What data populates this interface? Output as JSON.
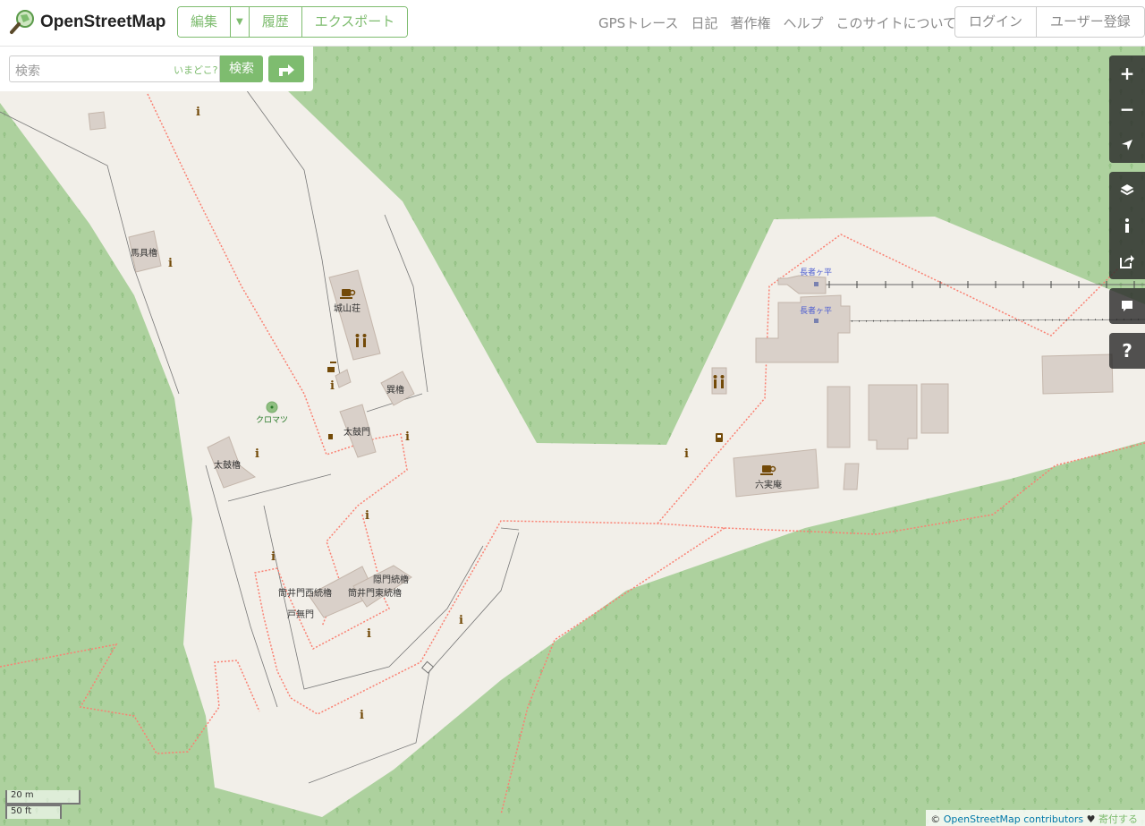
{
  "header": {
    "logo_text": "OpenStreetMap",
    "edit": "編集",
    "history": "履歴",
    "export": "エクスポート",
    "nav": [
      "GPSトレース",
      "日記",
      "著作権",
      "ヘルプ",
      "このサイトについて"
    ],
    "login": "ログイン",
    "signup": "ユーザー登録"
  },
  "search": {
    "placeholder": "検索",
    "where_am_i": "いまどこ?",
    "button": "検索"
  },
  "map": {
    "labels": {
      "bagu": "馬具櫓",
      "joyama": "城山荘",
      "tatsumi": "巽櫓",
      "kuromatsu": "クロマツ",
      "taiko_mon": "太鼓門",
      "taiko_yagura": "太鼓櫓",
      "tsutsui_west": "筒井門西続櫓",
      "tsutsui_east": "筒井門東続櫓",
      "kakure": "隠門続櫓",
      "tonashi": "戸無門",
      "chojagadaira_1": "長者ヶ平",
      "chojagadaira_2": "長者ヶ平",
      "rokujitsuan": "六実庵"
    }
  },
  "scale": {
    "metric": "20 m",
    "imperial": "50 ft"
  },
  "attribution": {
    "prefix": "©",
    "link": "OpenStreetMap contributors",
    "heart": "♥",
    "donate": "寄付する"
  },
  "colors": {
    "accent": "#7ebc6f",
    "forest": "#add19e",
    "land": "#f2efe9",
    "path": "#fa8072",
    "building": "#d9d0c9"
  }
}
